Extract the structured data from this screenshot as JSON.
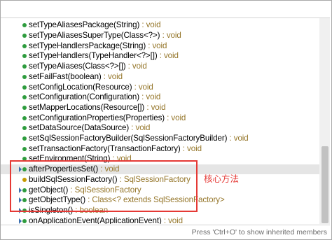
{
  "filter": {
    "value": ""
  },
  "methods": [
    {
      "name": "setTypeAliasesPackage(String)",
      "ret": " : void",
      "icon": "public-method-icon"
    },
    {
      "name": "setTypeAliasesSuperType(Class<?>)",
      "ret": " : void",
      "icon": "public-method-icon"
    },
    {
      "name": "setTypeHandlersPackage(String)",
      "ret": " : void",
      "icon": "public-method-icon"
    },
    {
      "name": "setTypeHandlers(TypeHandler<?>[])",
      "ret": " : void",
      "icon": "public-method-icon"
    },
    {
      "name": "setTypeAliases(Class<?>[])",
      "ret": " : void",
      "icon": "public-method-icon"
    },
    {
      "name": "setFailFast(boolean)",
      "ret": " : void",
      "icon": "public-method-icon"
    },
    {
      "name": "setConfigLocation(Resource)",
      "ret": " : void",
      "icon": "public-method-icon"
    },
    {
      "name": "setConfiguration(Configuration)",
      "ret": " : void",
      "icon": "public-method-icon"
    },
    {
      "name": "setMapperLocations(Resource[])",
      "ret": " : void",
      "icon": "public-method-icon"
    },
    {
      "name": "setConfigurationProperties(Properties)",
      "ret": " : void",
      "icon": "public-method-icon"
    },
    {
      "name": "setDataSource(DataSource)",
      "ret": " : void",
      "icon": "public-method-icon"
    },
    {
      "name": "setSqlSessionFactoryBuilder(SqlSessionFactoryBuilder)",
      "ret": " : void",
      "icon": "public-method-icon"
    },
    {
      "name": "setTransactionFactory(TransactionFactory)",
      "ret": " : void",
      "icon": "public-method-icon"
    },
    {
      "name": "setEnvironment(String)",
      "ret": " : void",
      "icon": "public-method-icon"
    },
    {
      "name": "afterPropertiesSet()",
      "ret": " : void",
      "icon": "override-method-icon",
      "selected": true
    },
    {
      "name": "buildSqlSessionFactory()",
      "ret": " : SqlSessionFactory",
      "icon": "protected-method-icon"
    },
    {
      "name": "getObject()",
      "ret": " : SqlSessionFactory",
      "icon": "override-method-icon"
    },
    {
      "name": "getObjectType()",
      "ret": " : Class<? extends SqlSessionFactory>",
      "icon": "override-method-icon"
    },
    {
      "name": "isSingleton()",
      "ret": " : boolean",
      "icon": "override-method-icon"
    },
    {
      "name": "onApplicationEvent(ApplicationEvent)",
      "ret": " : void",
      "icon": "override-method-icon"
    }
  ],
  "annotation": {
    "text": "核心方法",
    "color": "#e53935"
  },
  "status": {
    "text": "Press 'Ctrl+O' to show inherited members"
  },
  "colors": {
    "return_type": "#95762a",
    "public_dot": "#2e9c3e",
    "highlight": "#e53935"
  }
}
